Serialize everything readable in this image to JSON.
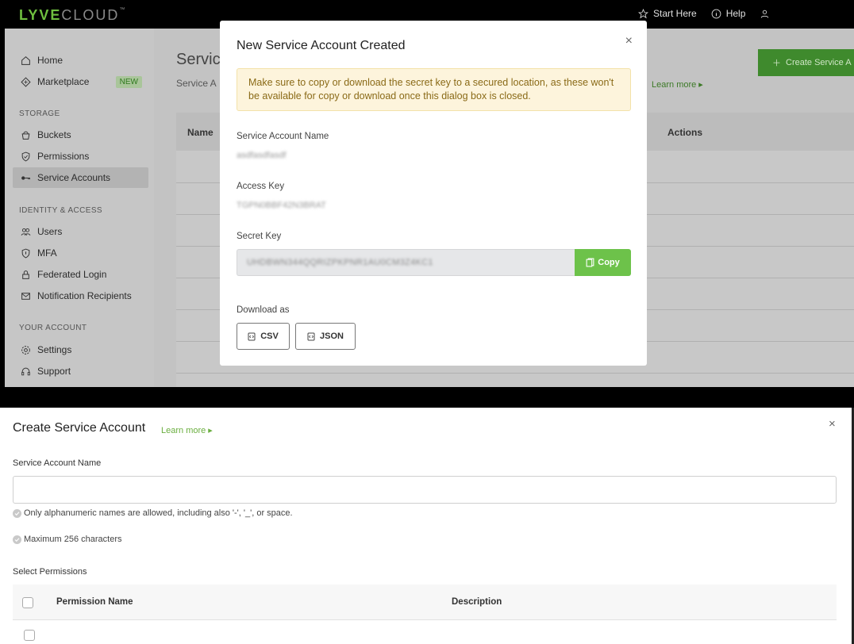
{
  "topbar": {
    "logo_part1": "LYVE",
    "logo_part2": "CLOUD",
    "logo_tm": "™",
    "start_here": "Start Here",
    "help": "Help"
  },
  "sidebar": {
    "home": "Home",
    "marketplace": "Marketplace",
    "marketplace_badge": "NEW",
    "section_storage": "STORAGE",
    "buckets": "Buckets",
    "permissions": "Permissions",
    "service_accounts": "Service Accounts",
    "section_identity": "IDENTITY & ACCESS",
    "users": "Users",
    "mfa": "MFA",
    "federated_login": "Federated Login",
    "notification_recipients": "Notification Recipients",
    "section_account": "YOUR ACCOUNT",
    "settings": "Settings",
    "support": "Support"
  },
  "main": {
    "title": "Servic",
    "subtitle": "Service A",
    "learn_more": "Learn more ▸",
    "create_button": "Create Service A",
    "col_name": "Name",
    "col_actions": "Actions"
  },
  "modal": {
    "title": "New Service Account Created",
    "close": "×",
    "alert": "Make sure to copy or download the secret key to a secured location, as these won't be available for copy or download once this dialog box is closed.",
    "name_label": "Service Account Name",
    "name_value": "asdfasdfasdf",
    "access_label": "Access Key",
    "access_value": "TGPN0BBF42N3BRAT",
    "secret_label": "Secret Key",
    "secret_value": "UHDBWN344QQRIZPKPNR1AU0CM3Z4KC1",
    "copy": "Copy",
    "download_label": "Download as",
    "csv": "CSV",
    "json": "JSON"
  },
  "create_panel": {
    "title": "Create Service Account",
    "learn_more": "Learn more ▸",
    "close": "×",
    "name_label": "Service Account Name",
    "name_value": "",
    "hint1": "Only alphanumeric names are allowed, including also '-', '_', or space.",
    "hint2": "Maximum 256 characters",
    "permissions_label": "Select Permissions",
    "col_permission_name": "Permission Name",
    "col_description": "Description"
  },
  "colors": {
    "brand_green": "#6dc24a",
    "alert_bg": "#fdf4dc",
    "alert_text": "#8a6a17"
  }
}
